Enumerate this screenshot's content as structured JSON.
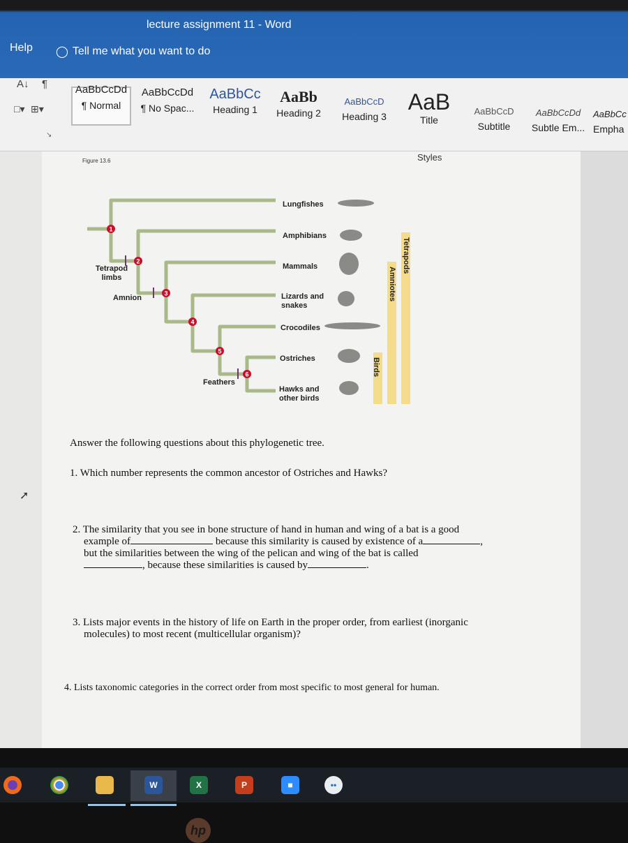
{
  "window": {
    "title": "lecture assignment 11  -  Word"
  },
  "menu": {
    "help": "Help",
    "tell_me": "Tell me what you want to do"
  },
  "ribbon": {
    "styles": [
      {
        "preview": "AaBbCcDd",
        "label": "¶ Normal",
        "selected": true
      },
      {
        "preview": "AaBbCcDd",
        "label": "¶ No Spac..."
      },
      {
        "preview": "AaBbCc",
        "label": "Heading 1"
      },
      {
        "preview": "AaBb",
        "label": "Heading 2"
      },
      {
        "preview": "AaBbCcD",
        "label": "Heading 3"
      },
      {
        "preview": "AaB",
        "label": "Title"
      },
      {
        "preview": "AaBbCcD",
        "label": "Subtitle"
      },
      {
        "preview": "AaBbCcDd",
        "label": "Subtle Em..."
      },
      {
        "preview": "AaBbCc",
        "label": "Empha"
      }
    ],
    "group_label": "Styles"
  },
  "figure": {
    "caption": "Figure 13.6",
    "taxa": [
      "Lungfishes",
      "Amphibians",
      "Mammals",
      "Lizards and snakes",
      "Crocodiles",
      "Ostriches",
      "Hawks and other birds"
    ],
    "nodes": [
      "1",
      "2",
      "3",
      "4",
      "5",
      "6"
    ],
    "traits": [
      "Tetrapod limbs",
      "Amnion",
      "Feathers"
    ],
    "clades": [
      "Birds",
      "Amniotes",
      "Tetrapods"
    ],
    "branch_color": "#a9b98a",
    "node_color": "#c8102e",
    "clade_color": "#f5dc8a"
  },
  "questions": {
    "intro": "Answer the following questions about this phylogenetic tree.",
    "q1": "1.  Which number represents the common ancestor of Ostriches and Hawks?",
    "q2": {
      "a": "2.  The similarity that you see in bone structure of hand in human and wing of a bat is a good",
      "b": "example of",
      "c": "because this similarity is caused by existence of a",
      "d": "but the similarities between the wing of the pelican and wing of the bat  is called",
      "e": ", because these similarities is caused by"
    },
    "q3": {
      "a": "3.  Lists major events in the history of life on Earth in the proper order, from earliest (inorganic",
      "b": "molecules) to most recent (multicellular organism)?"
    },
    "q4": "4.  Lists taxonomic categories in the correct order from most specific to most general for human."
  },
  "taskbar": {
    "apps": [
      "firefox",
      "chrome",
      "file-explorer",
      "word",
      "excel",
      "powerpoint",
      "zoom",
      "other"
    ],
    "active": "word",
    "word": "W",
    "excel": "X",
    "powerpoint": "P"
  },
  "bezel": {
    "logo": "hp"
  }
}
